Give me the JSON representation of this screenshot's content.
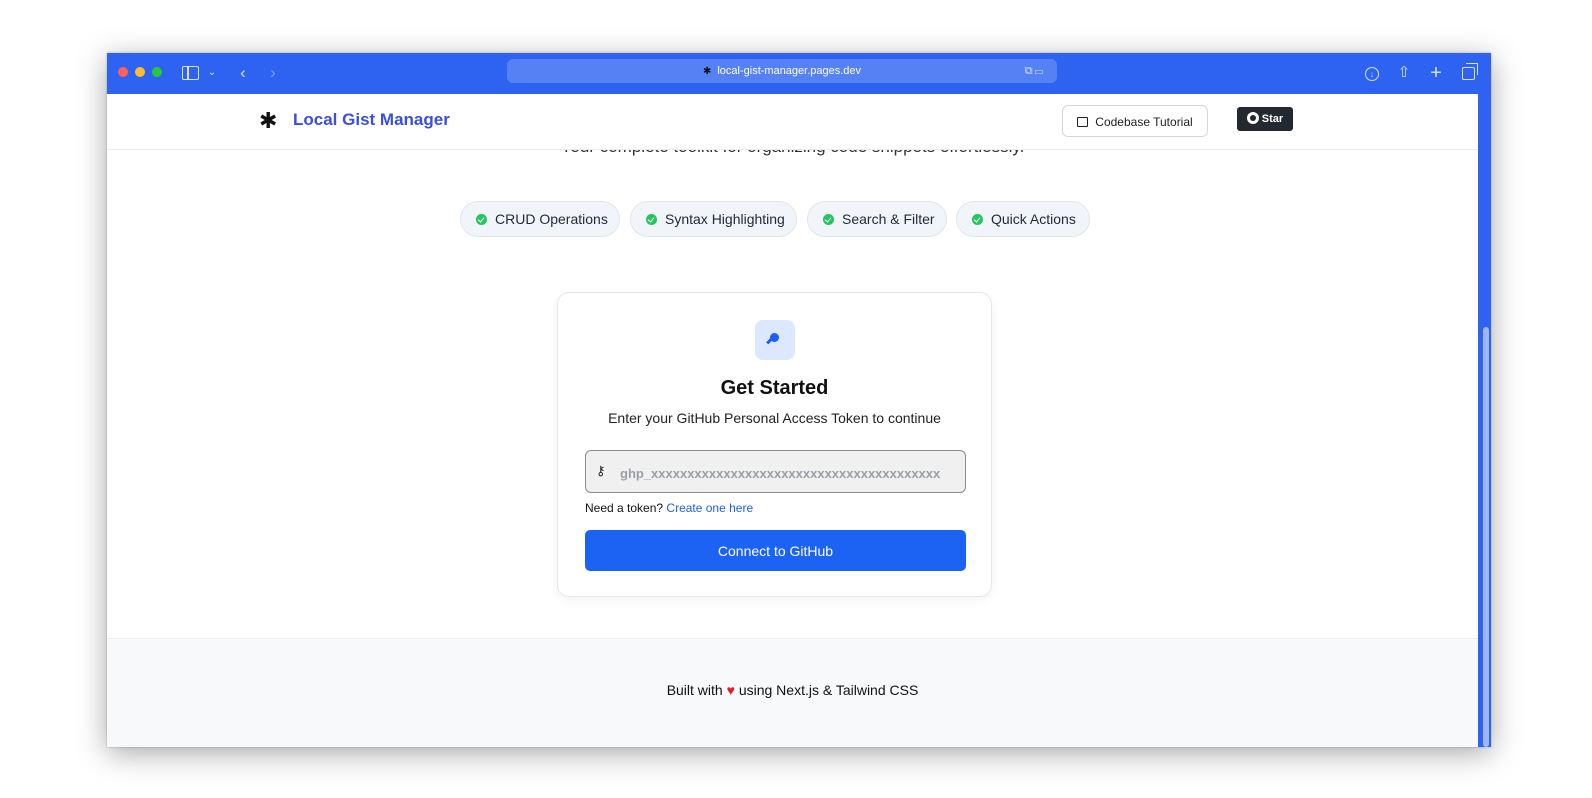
{
  "browser": {
    "url": "local-gist-manager.pages.dev"
  },
  "navbar": {
    "brand": "Local Gist Manager",
    "tutorial_label": "Codebase Tutorial",
    "star_label": "Star"
  },
  "hero": {
    "subtitle": "Your complete toolkit for organizing code snippets effortlessly."
  },
  "features": [
    {
      "label": "CRUD Operations"
    },
    {
      "label": "Syntax Highlighting"
    },
    {
      "label": "Search & Filter"
    },
    {
      "label": "Quick Actions"
    }
  ],
  "card": {
    "title": "Get Started",
    "subtitle": "Enter your GitHub Personal Access Token to continue",
    "token_placeholder": "ghp_xxxxxxxxxxxxxxxxxxxxxxxxxxxxxxxxxxxxxxxx",
    "help_prefix": "Need a token?",
    "help_link": "Create one here",
    "connect_label": "Connect to GitHub"
  },
  "footer": {
    "prefix": "Built with",
    "heart": "♥",
    "suffix": "using Next.js & Tailwind CSS"
  }
}
